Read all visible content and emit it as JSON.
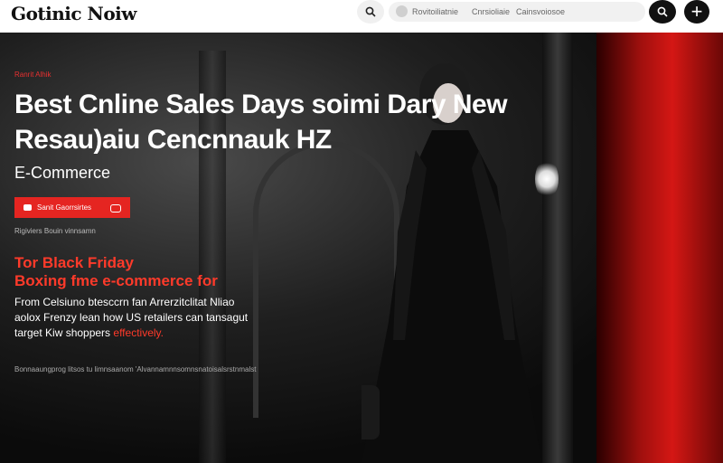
{
  "header": {
    "logo": "Gotinic Noiw",
    "nav": [
      "Rovitoiliatnie",
      "Cnrsioliaie",
      "Cainsvoiosoe"
    ],
    "plus": "+"
  },
  "hero": {
    "tag": "Ranrit Alhik",
    "title_line1": "Best Cnline Sales Days soimi Dary  New",
    "title_line2": "Resau)aiu Cencnnauk HZ",
    "subhead": "E-Commerce",
    "button_label": "Sanit Gaorrsirtes",
    "meta": "Rigiviers Bouin vinnsamn",
    "red_heading_line1": "Tor  Black Friday",
    "red_heading_line2": "Boxing fme e-commerce for",
    "description_prefix": "From Celsiuno btesccrn fan Arrerzitclitat Nliao aolox Frenzy lean how US retailers can tansagut target Kiw shoppers ",
    "description_emphasis": "effectively.",
    "footer": "Bonnaaungprog litsos tu limnsaanom 'Alvannamnnsomnsnatoisalsrstnmalst"
  },
  "colors": {
    "accent_red": "#e52521",
    "text_red": "#ff3a2a",
    "topbar_bg": "#ffffff",
    "hero_bg": "#0b0b0b"
  },
  "icons": [
    "search-icon",
    "avatar-icon",
    "search-icon",
    "plus-icon",
    "tag-icon",
    "chat-icon"
  ]
}
